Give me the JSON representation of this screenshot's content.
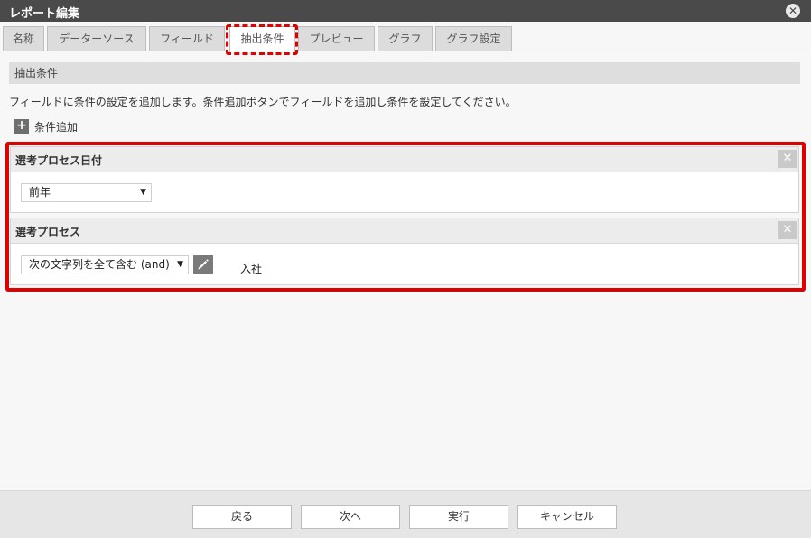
{
  "window": {
    "title": "レポート編集"
  },
  "tabs": [
    {
      "label": "名称"
    },
    {
      "label": "データーソース"
    },
    {
      "label": "フィールド"
    },
    {
      "label": "抽出条件"
    },
    {
      "label": "プレビュー"
    },
    {
      "label": "グラフ"
    },
    {
      "label": "グラフ設定"
    }
  ],
  "active_tab": "抽出条件",
  "section": {
    "title": "抽出条件",
    "description": "フィールドに条件の設定を追加します。条件追加ボタンでフィールドを追加し条件を設定してください。",
    "add_label": "条件追加"
  },
  "conditions": [
    {
      "field": "選考プロセス日付",
      "operator": "前年"
    },
    {
      "field": "選考プロセス",
      "operator": "次の文字列を全て含む (and)",
      "value": "入社"
    }
  ],
  "footer": {
    "back": "戻る",
    "next": "次へ",
    "run": "実行",
    "cancel": "キャンセル"
  },
  "colors": {
    "highlight": "#e00000",
    "titlebar": "#4a4a4a"
  }
}
